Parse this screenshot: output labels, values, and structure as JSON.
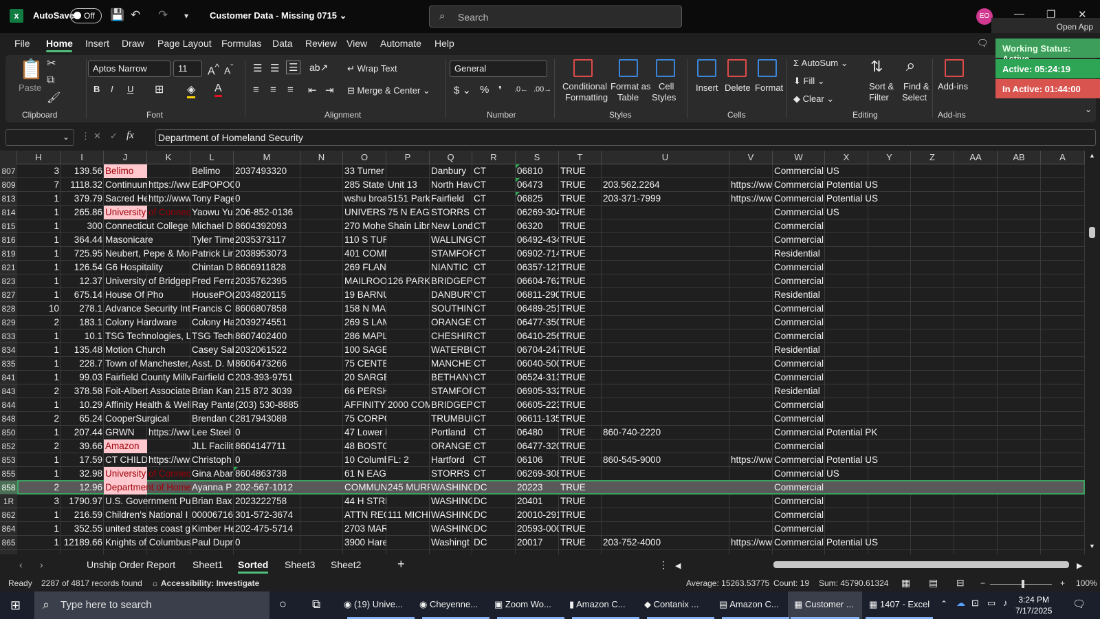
{
  "titlebar": {
    "autosave": "AutoSave",
    "toggle": "Off",
    "title": "Customer Data - Missing 0715",
    "search_placeholder": "Search",
    "avatar": "EO"
  },
  "menu": [
    "File",
    "Home",
    "Insert",
    "Draw",
    "Page Layout",
    "Formulas",
    "Data",
    "Review",
    "View",
    "Automate",
    "Help"
  ],
  "ribbon": {
    "clipboard": {
      "paste": "Paste",
      "label": "Clipboard"
    },
    "font": {
      "name": "Aptos Narrow",
      "size": "11",
      "label": "Font"
    },
    "alignment": {
      "wrap": "Wrap Text",
      "merge": "Merge & Center",
      "label": "Alignment"
    },
    "number": {
      "format": "General",
      "label": "Number"
    },
    "styles": {
      "conditional": "Conditional",
      "conditional2": "Formatting",
      "format_as": "Format as",
      "format_as2": "Table",
      "cell": "Cell",
      "cell2": "Styles",
      "label": "Styles"
    },
    "cells": {
      "insert": "Insert",
      "delete": "Delete",
      "format": "Format",
      "label": "Cells"
    },
    "editing": {
      "autosum": "AutoSum",
      "fill": "Fill",
      "clear": "Clear",
      "sort": "Sort &",
      "sort2": "Filter",
      "find": "Find &",
      "find2": "Select",
      "label": "Editing"
    },
    "addins": {
      "addins": "Add-ins",
      "label": "Add-ins"
    }
  },
  "overlay": {
    "open_app": "Open App",
    "working_status": "Working Status: Active",
    "active": "Active: 05:24:19",
    "inactive": "In Active: 01:44:00"
  },
  "formula": {
    "text": "Department of Homeland Security"
  },
  "columns": [
    "H",
    "I",
    "J",
    "K",
    "L",
    "M",
    "N",
    "O",
    "P",
    "Q",
    "R",
    "S",
    "T",
    "U",
    "V",
    "W",
    "X",
    "Y",
    "Z",
    "AA",
    "AB",
    "A"
  ],
  "rows": [
    {
      "n": "807",
      "H": "3",
      "I": "139.56",
      "J": "Belimo",
      "K": "",
      "L": "Belimo",
      "M": "2037493320",
      "O": "33 Turner",
      "P": "",
      "Q": "Danbury",
      "R": "CT",
      "S": "06810",
      "T": "TRUE",
      "U": "",
      "V": "",
      "W": "Commercial",
      "X": "US",
      "pink": true
    },
    {
      "n": "809",
      "H": "7",
      "I": "1118.32",
      "J": "Continuum",
      "K": "https://ww",
      "L": "EdPOPO0(",
      "M": "0",
      "O": "285 State S",
      "P": "Unit 13",
      "Q": "North Hav",
      "R": "CT",
      "S": "06473",
      "T": "TRUE",
      "U": "203.562.2264",
      "V": "https://ww",
      "W": "Commercial",
      "X": "Potential US"
    },
    {
      "n": "813",
      "H": "1",
      "I": "379.79",
      "J": "Sacred He",
      "K": "http://www",
      "L": "Tony Page",
      "M": "0",
      "O": "wshu broa",
      "P": "5151 Park",
      "Q": "Fairfield",
      "R": "CT",
      "S": "06825",
      "T": "TRUE",
      "U": "203-371-7999",
      "V": "https://ww",
      "W": "Commercial",
      "X": "Potential US"
    },
    {
      "n": "814",
      "H": "1",
      "I": "265.86",
      "J": "University of Connec",
      "K": "",
      "L": "Yaowu Yu",
      "M": "206-852-0136",
      "O": "UNIVERSIT",
      "P": "75 N EAGL",
      "Q": "STORRS",
      "R": "CT",
      "S": "06269-304",
      "T": "TRUE",
      "U": "",
      "V": "",
      "W": "Commercial",
      "X": "US",
      "pink": true
    },
    {
      "n": "815",
      "H": "1",
      "I": "300",
      "J": "Connecticut College",
      "K": "",
      "L": "Michael D",
      "M": "8604392093",
      "O": "270 Mohe",
      "P": "Shain Libr",
      "Q": "New Lond",
      "R": "CT",
      "S": "06320",
      "T": "TRUE",
      "U": "",
      "V": "",
      "W": "Commercial",
      "X": ""
    },
    {
      "n": "816",
      "H": "1",
      "I": "364.44",
      "J": "Masonicare",
      "K": "",
      "L": "Tyler Time",
      "M": "2035373117",
      "O": "110 S TURI",
      "P": "",
      "Q": "WALLINGF",
      "R": "CT",
      "S": "06492-434",
      "T": "TRUE",
      "U": "",
      "V": "",
      "W": "Commercial",
      "X": ""
    },
    {
      "n": "819",
      "H": "1",
      "I": "725.95",
      "J": "Neubert, Pepe & Mor",
      "K": "",
      "L": "Patrick Lir",
      "M": "2038953073",
      "O": "401 COMM",
      "P": "",
      "Q": "STAMFORI",
      "R": "CT",
      "S": "06902-714",
      "T": "TRUE",
      "U": "",
      "V": "",
      "W": "Residential",
      "X": ""
    },
    {
      "n": "821",
      "H": "1",
      "I": "126.54",
      "J": "G6 Hospitality",
      "K": "",
      "L": "Chintan D",
      "M": "8606911828",
      "O": "269 FLAND",
      "P": "",
      "Q": "NIANTIC",
      "R": "CT",
      "S": "06357-121",
      "T": "TRUE",
      "U": "",
      "V": "",
      "W": "Commercial",
      "X": ""
    },
    {
      "n": "823",
      "H": "1",
      "I": "12.37",
      "J": "University of Bridgep",
      "K": "",
      "L": "Fred Ferra",
      "M": "2035762395",
      "O": "MAILROOI",
      "P": "126 PARK /",
      "Q": "BRIDGEPC",
      "R": "CT",
      "S": "06604-762",
      "T": "TRUE",
      "U": "",
      "V": "",
      "W": "Commercial",
      "X": ""
    },
    {
      "n": "827",
      "H": "1",
      "I": "675.14",
      "J": "House Of Pho",
      "K": "",
      "L": "HousePO(",
      "M": "2034820115",
      "O": "19 BARNU",
      "P": "",
      "Q": "DANBURY",
      "R": "CT",
      "S": "06811-290",
      "T": "TRUE",
      "U": "",
      "V": "",
      "W": "Residential",
      "X": ""
    },
    {
      "n": "828",
      "H": "10",
      "I": "278.1",
      "J": "Advance Security Inte",
      "K": "",
      "L": "Francis C",
      "M": "8606807858",
      "O": "158 N MAI",
      "P": "",
      "Q": "SOUTHIN(",
      "R": "CT",
      "S": "06489-251",
      "T": "TRUE",
      "U": "",
      "V": "",
      "W": "Commercial",
      "X": ""
    },
    {
      "n": "829",
      "H": "2",
      "I": "183.1",
      "J": "Colony Hardware",
      "K": "",
      "L": "Colony Ha",
      "M": "2039274551",
      "O": "269 S LAM",
      "P": "",
      "Q": "ORANGE",
      "R": "CT",
      "S": "06477-350",
      "T": "TRUE",
      "U": "",
      "V": "",
      "W": "Commercial",
      "X": ""
    },
    {
      "n": "833",
      "H": "1",
      "I": "10.1",
      "J": "TSG Technologies, LL",
      "K": "",
      "L": "TSG Techr",
      "M": "8607402400",
      "O": "286 MAPLE",
      "P": "",
      "Q": "CHESHIRE",
      "R": "CT",
      "S": "06410-256",
      "T": "TRUE",
      "U": "",
      "V": "",
      "W": "Commercial",
      "X": ""
    },
    {
      "n": "834",
      "H": "1",
      "I": "135.48",
      "J": "Motion Church",
      "K": "",
      "L": "Casey Sab",
      "M": "2032061522",
      "O": "100 SAGE I",
      "P": "",
      "Q": "WATERBUI",
      "R": "CT",
      "S": "06704-247",
      "T": "TRUE",
      "U": "",
      "V": "",
      "W": "Residential",
      "X": ""
    },
    {
      "n": "835",
      "H": "1",
      "I": "228.7",
      "J": "Town of Manchester,",
      "K": "",
      "L": "Asst. D. M",
      "M": "8606473266",
      "O": "75 CENTEF",
      "P": "",
      "Q": "MANCHES",
      "R": "CT",
      "S": "06040-500",
      "T": "TRUE",
      "U": "",
      "V": "",
      "W": "Commercial",
      "X": ""
    },
    {
      "n": "841",
      "H": "1",
      "I": "99.03",
      "J": "Fairfield County Millv",
      "K": "",
      "L": "Fairfield C",
      "M": "203-393-9751",
      "O": "20 SARGEN",
      "P": "",
      "Q": "BETHANY",
      "R": "CT",
      "S": "06524-313",
      "T": "TRUE",
      "U": "",
      "V": "",
      "W": "Commercial",
      "X": ""
    },
    {
      "n": "843",
      "H": "2",
      "I": "378.58",
      "J": "Foit-Albert Associate",
      "K": "",
      "L": "Brian Kan",
      "M": "215 872 3039",
      "O": "66 PERSHI",
      "P": "",
      "Q": "STAMFORI",
      "R": "CT",
      "S": "06905-332",
      "T": "TRUE",
      "U": "",
      "V": "",
      "W": "Residential",
      "X": ""
    },
    {
      "n": "844",
      "H": "1",
      "I": "10.29",
      "J": "Affinity Health & Well",
      "K": "",
      "L": "Ray Panta",
      "M": "(203) 530-8885",
      "O": "AFFINITY I",
      "P": "2000 COM",
      "Q": "BRIDGEPC",
      "R": "CT",
      "S": "06605-223",
      "T": "TRUE",
      "U": "",
      "V": "",
      "W": "Commercial",
      "X": ""
    },
    {
      "n": "848",
      "H": "2",
      "I": "65.24",
      "J": "CooperSurgical",
      "K": "",
      "L": "Brendan C",
      "M": "2817943088",
      "O": "75 CORPO",
      "P": "",
      "Q": "TRUMBULI",
      "R": "CT",
      "S": "06611-135",
      "T": "TRUE",
      "U": "",
      "V": "",
      "W": "Commercial",
      "X": ""
    },
    {
      "n": "850",
      "H": "1",
      "I": "207.44",
      "J": "GRWN",
      "K": "https://ww",
      "L": "Lee Steel (",
      "M": "0",
      "O": "47 Lower N",
      "P": "",
      "Q": "Portland",
      "R": "CT",
      "S": "06480",
      "T": "TRUE",
      "U": "860-740-2220",
      "V": "",
      "W": "Commercial",
      "X": "Potential PK"
    },
    {
      "n": "852",
      "H": "2",
      "I": "39.66",
      "J": "Amazon",
      "K": "",
      "L": "JLL Faciliti",
      "M": "8604147711",
      "O": "48 BOSTOI",
      "P": "",
      "Q": "ORANGE",
      "R": "CT",
      "S": "06477-320",
      "T": "TRUE",
      "U": "",
      "V": "",
      "W": "Commercial",
      "X": "",
      "pink": true
    },
    {
      "n": "853",
      "H": "1",
      "I": "17.59",
      "J": "CT CHILDR",
      "K": "https://ww",
      "L": "Christoph",
      "M": "0",
      "O": "10 Columb",
      "P": "FL: 2",
      "Q": "Hartford",
      "R": "CT",
      "S": "06106",
      "T": "TRUE",
      "U": "860-545-9000",
      "V": "https://ww",
      "W": "Commercial",
      "X": "Potential US"
    },
    {
      "n": "855",
      "H": "1",
      "I": "32.98",
      "J": "University of Connec",
      "K": "",
      "L": "Gina Abar",
      "M": "8604863738",
      "O": "61 N EAGL",
      "P": "",
      "Q": "STORRS",
      "R": "CT",
      "S": "06269-308",
      "T": "TRUE",
      "U": "",
      "V": "",
      "W": "Commercial",
      "X": "US",
      "pink": true
    },
    {
      "n": "858",
      "H": "2",
      "I": "12.96",
      "J": "Department of Home",
      "K": "",
      "L": "Ayanna P",
      "M": "202-567-1012",
      "O": "COMMUNI",
      "P": "245 MURR",
      "Q": "WASHING",
      "R": "DC",
      "S": "20223",
      "T": "TRUE",
      "U": "",
      "V": "",
      "W": "Commercial",
      "X": "",
      "pink": true,
      "sel": true
    },
    {
      "n": "1R",
      "H": "3",
      "I": "1790.97",
      "J": "U.S. Government Pub",
      "K": "",
      "L": "Brian Bax",
      "M": "2023222758",
      "O": "44 H STREI",
      "P": "",
      "Q": "WASHING",
      "R": "DC",
      "S": "20401",
      "T": "TRUE",
      "U": "",
      "V": "",
      "W": "Commercial",
      "X": ""
    },
    {
      "n": "862",
      "H": "1",
      "I": "216.59",
      "J": "Children's National I",
      "K": "",
      "L": "00006716C",
      "M": "301-572-3674",
      "O": "ATTN RECI",
      "P": "111 MICHI",
      "Q": "WASHING",
      "R": "DC",
      "S": "20010-291",
      "T": "TRUE",
      "U": "",
      "V": "",
      "W": "Commercial",
      "X": ""
    },
    {
      "n": "864",
      "H": "1",
      "I": "352.55",
      "J": "united states coast g",
      "K": "",
      "L": "Kimber He",
      "M": "202-475-5714",
      "O": "2703 MAR",
      "P": "",
      "Q": "WASHING",
      "R": "DC",
      "S": "20593-000",
      "T": "TRUE",
      "U": "",
      "V": "",
      "W": "Commercial",
      "X": ""
    },
    {
      "n": "865",
      "H": "1",
      "I": "12189.66",
      "J": "Knights of Columbus",
      "K": "",
      "L": "Paul Dupr",
      "M": "0",
      "O": "3900 Hare",
      "P": "",
      "Q": "Washingt",
      "R": "DC",
      "S": "20017",
      "T": "TRUE",
      "U": "203-752-4000",
      "V": "https://ww",
      "W": "Commercial",
      "X": "Potential US"
    }
  ],
  "sheets": [
    "Unship Order Report",
    "Sheet1",
    "Sorted",
    "Sheet3",
    "Sheet2"
  ],
  "active_sheet": "Sorted",
  "status": {
    "ready": "Ready",
    "records": "2287 of 4817 records found",
    "accessibility": "Accessibility: Investigate",
    "average": "Average: 15263.53775",
    "count": "Count: 19",
    "sum": "Sum: 45790.61324",
    "zoom": "100%"
  },
  "taskbar": {
    "search": "Type here to search",
    "apps": [
      "(19) Unive...",
      "Cheyenne...",
      "Zoom Wo...",
      "Amazon C...",
      "Contanix ...",
      "Amazon C...",
      "Customer ...",
      "1407 - Excel"
    ],
    "time": "3:24 PM",
    "date": "7/17/2025"
  }
}
